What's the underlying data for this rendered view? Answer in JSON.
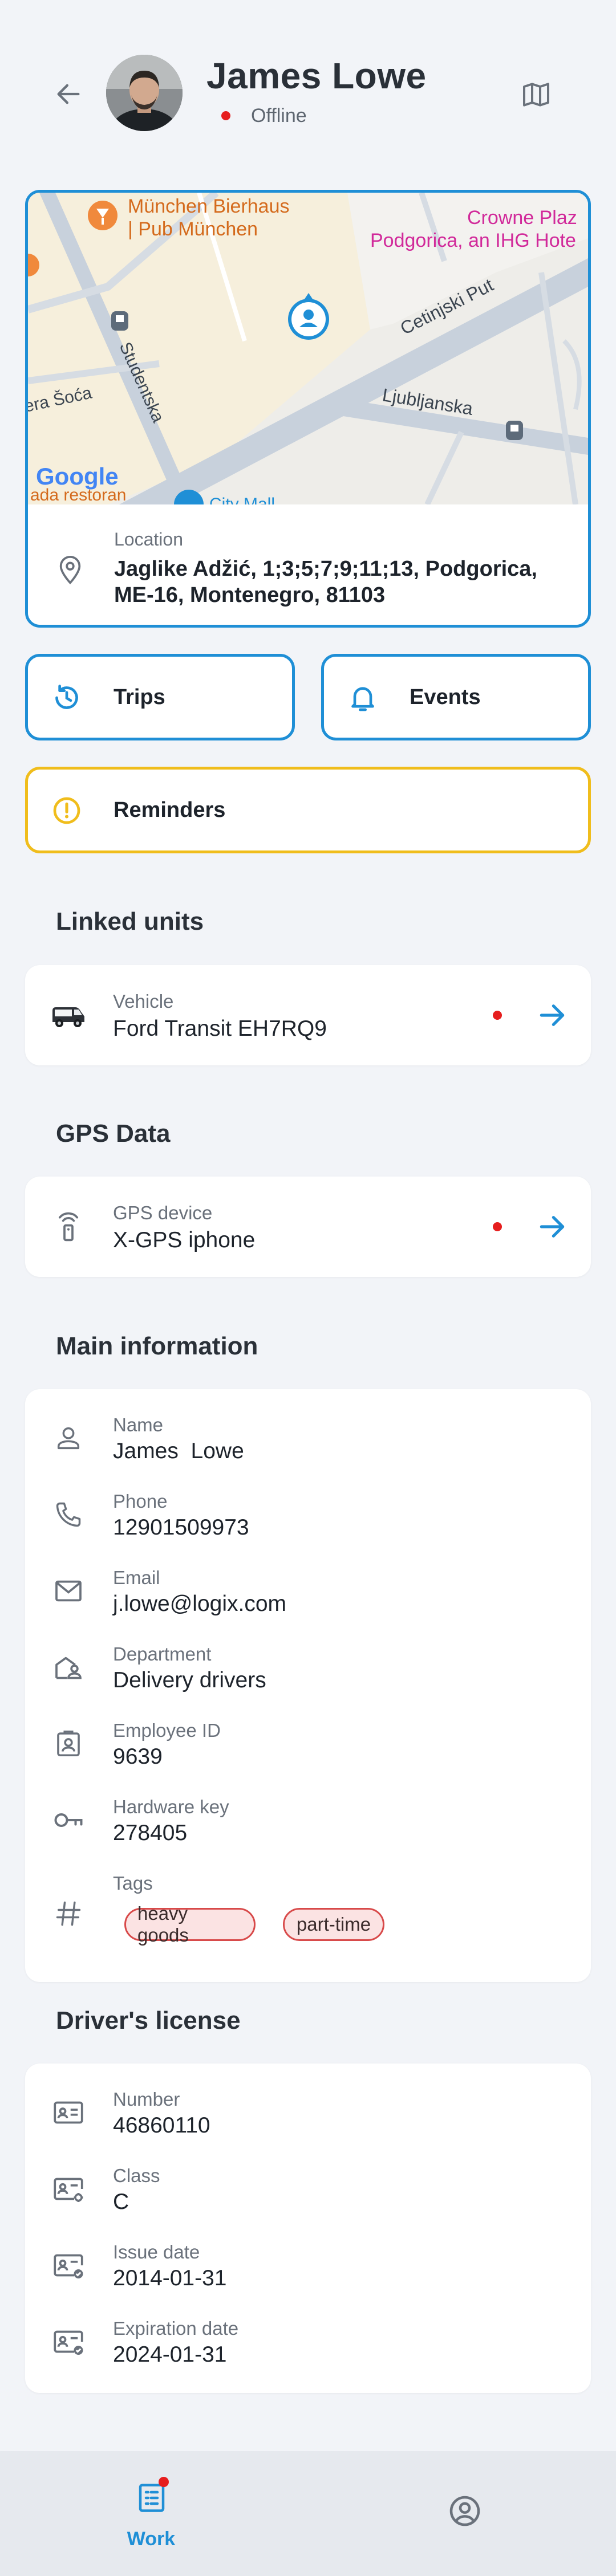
{
  "header": {
    "driver_name": "James Lowe",
    "status": "Offline",
    "status_color": "#e61e1e"
  },
  "location": {
    "map_labels": {
      "bierhaus": "München Bierhaus",
      "bierhaus_sub": "| Pub München",
      "crowne": "Crowne Plaz",
      "crowne_sub": "Podgorica, an IHG Hote",
      "cetinjski": "Cetinjski Put",
      "studentska": "Studentska",
      "ljubljanska": "Ljubljanska",
      "soca": "era Šoća",
      "ada": "ada restoran",
      "city_mall": "City Mall",
      "google": "Google"
    },
    "label": "Location",
    "value": "Jaglike Adžić, 1;3;5;7;9;11;13, Podgorica, ME-16, Montenegro, 81103"
  },
  "actions": {
    "trips": "Trips",
    "events": "Events",
    "reminders": "Reminders"
  },
  "linked_units": {
    "title": "Linked units",
    "label": "Vehicle",
    "value": "Ford Transit EH7RQ9"
  },
  "gps_data": {
    "title": "GPS Data",
    "label": "GPS device",
    "value": "X-GPS iphone"
  },
  "main_info": {
    "title": "Main information",
    "name_label": "Name",
    "name_value": "James  Lowe",
    "phone_label": "Phone",
    "phone_value": "12901509973",
    "email_label": "Email",
    "email_value": "j.lowe@logix.com",
    "department_label": "Department",
    "department_value": "Delivery drivers",
    "employee_id_label": "Employee ID",
    "employee_id_value": "9639",
    "hardware_key_label": "Hardware key",
    "hardware_key_value": "278405",
    "tags_label": "Tags",
    "tags": [
      "heavy goods",
      "part-time"
    ]
  },
  "license": {
    "title": "Driver's license",
    "number_label": "Number",
    "number_value": "46860110",
    "class_label": "Class",
    "class_value": "C",
    "issue_label": "Issue date",
    "issue_value": "2014-01-31",
    "expiration_label": "Expiration date",
    "expiration_value": "2024-01-31"
  },
  "nav": {
    "work": "Work"
  },
  "colors": {
    "accent": "#1f8fd6",
    "warning": "#f0bd1c",
    "status_red": "#e61e1e",
    "background": "#f2f4f8"
  }
}
